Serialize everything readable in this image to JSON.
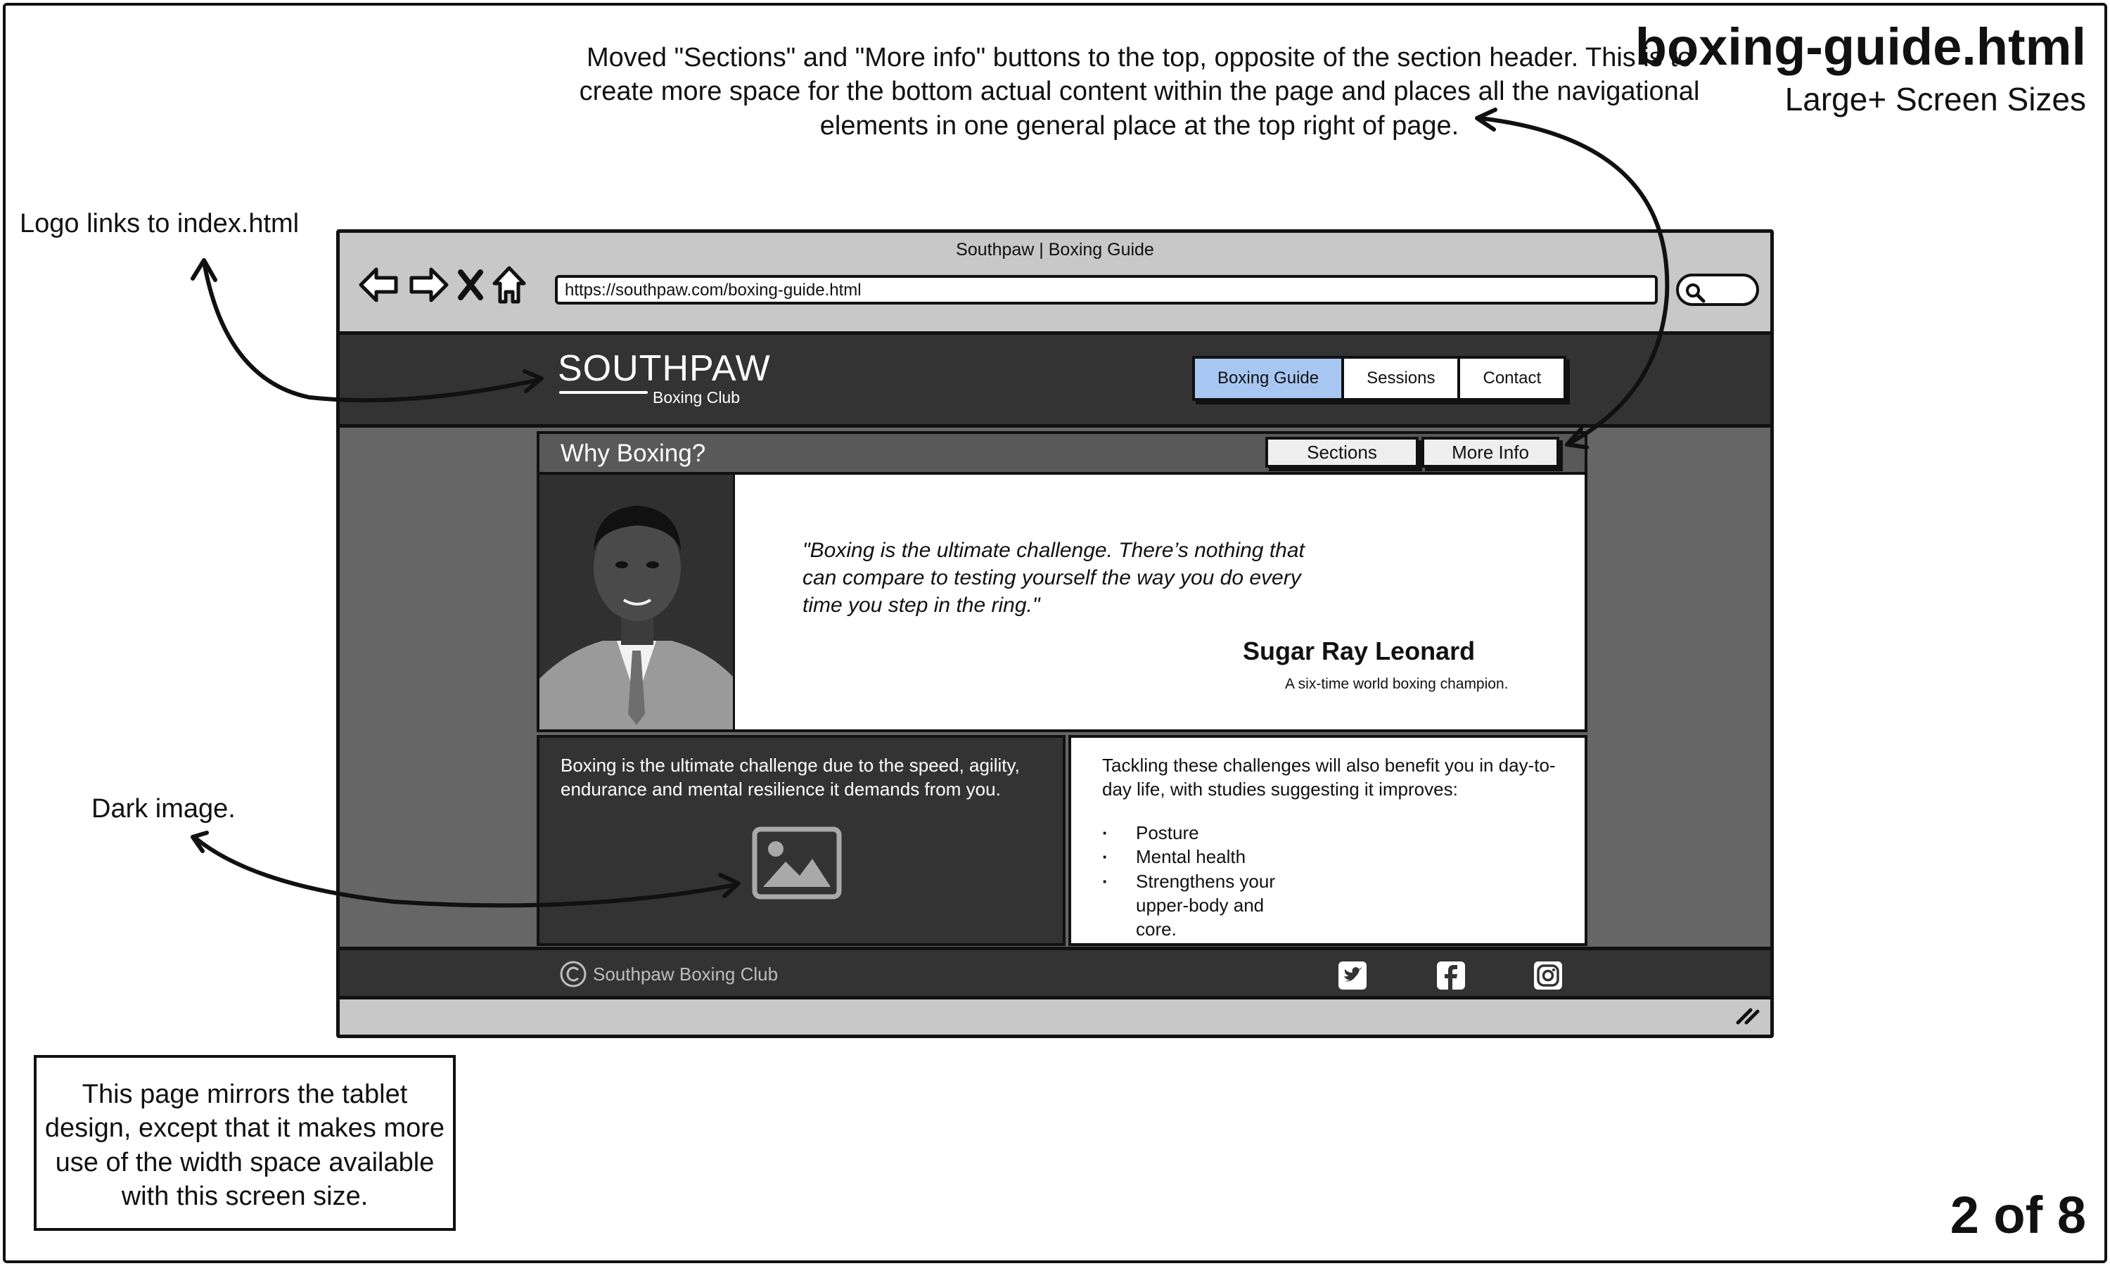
{
  "sheet": {
    "file_name": "boxing-guide.html",
    "screen_size": "Large+ Screen Sizes",
    "page_count": "2 of 8"
  },
  "annotations": {
    "top_note": "Moved \"Sections\" and \"More info\" buttons to the top, opposite of the section header. This is to create more space for the bottom actual content within the page and places all the navigational elements in one general place at the top right of page.",
    "logo_note": "Logo links to index.html",
    "image_note": "Dark image.",
    "box_note": "This page mirrors the tablet design, except that it makes more use of the width space available with this screen size."
  },
  "browser": {
    "tab_title": "Southpaw | Boxing Guide",
    "url": "https://southpaw.com/boxing-guide.html"
  },
  "site": {
    "logo_main": "SOUTHPAW",
    "logo_tagline": "Boxing Club",
    "nav": [
      "Boxing Guide",
      "Sessions",
      "Contact"
    ],
    "active_nav": "Boxing Guide",
    "accent_color": "#a7c7f2"
  },
  "section": {
    "heading": "Why Boxing?",
    "sections_button": "Sections",
    "more_info_button": "More Info"
  },
  "hero": {
    "quote": "\"Boxing is the ultimate challenge. There’s nothing that can compare to testing yourself the way you do every time you step in the ring.\"",
    "author": "Sugar Ray Leonard",
    "author_desc": "A six-time world boxing champion."
  },
  "dark_card": {
    "text": "Boxing is the ultimate challenge due to the speed, agility, endurance and mental resilience it demands from you."
  },
  "light_card": {
    "text": "Tackling these challenges will also benefit you in day-to-day life, with studies suggesting it improves:",
    "items": [
      "Posture",
      "Mental health",
      "Strengthens your upper-body and core."
    ]
  },
  "footer": {
    "copyright": "Southpaw Boxing Club",
    "icons": [
      "twitter-icon",
      "facebook-icon",
      "instagram-icon"
    ]
  }
}
